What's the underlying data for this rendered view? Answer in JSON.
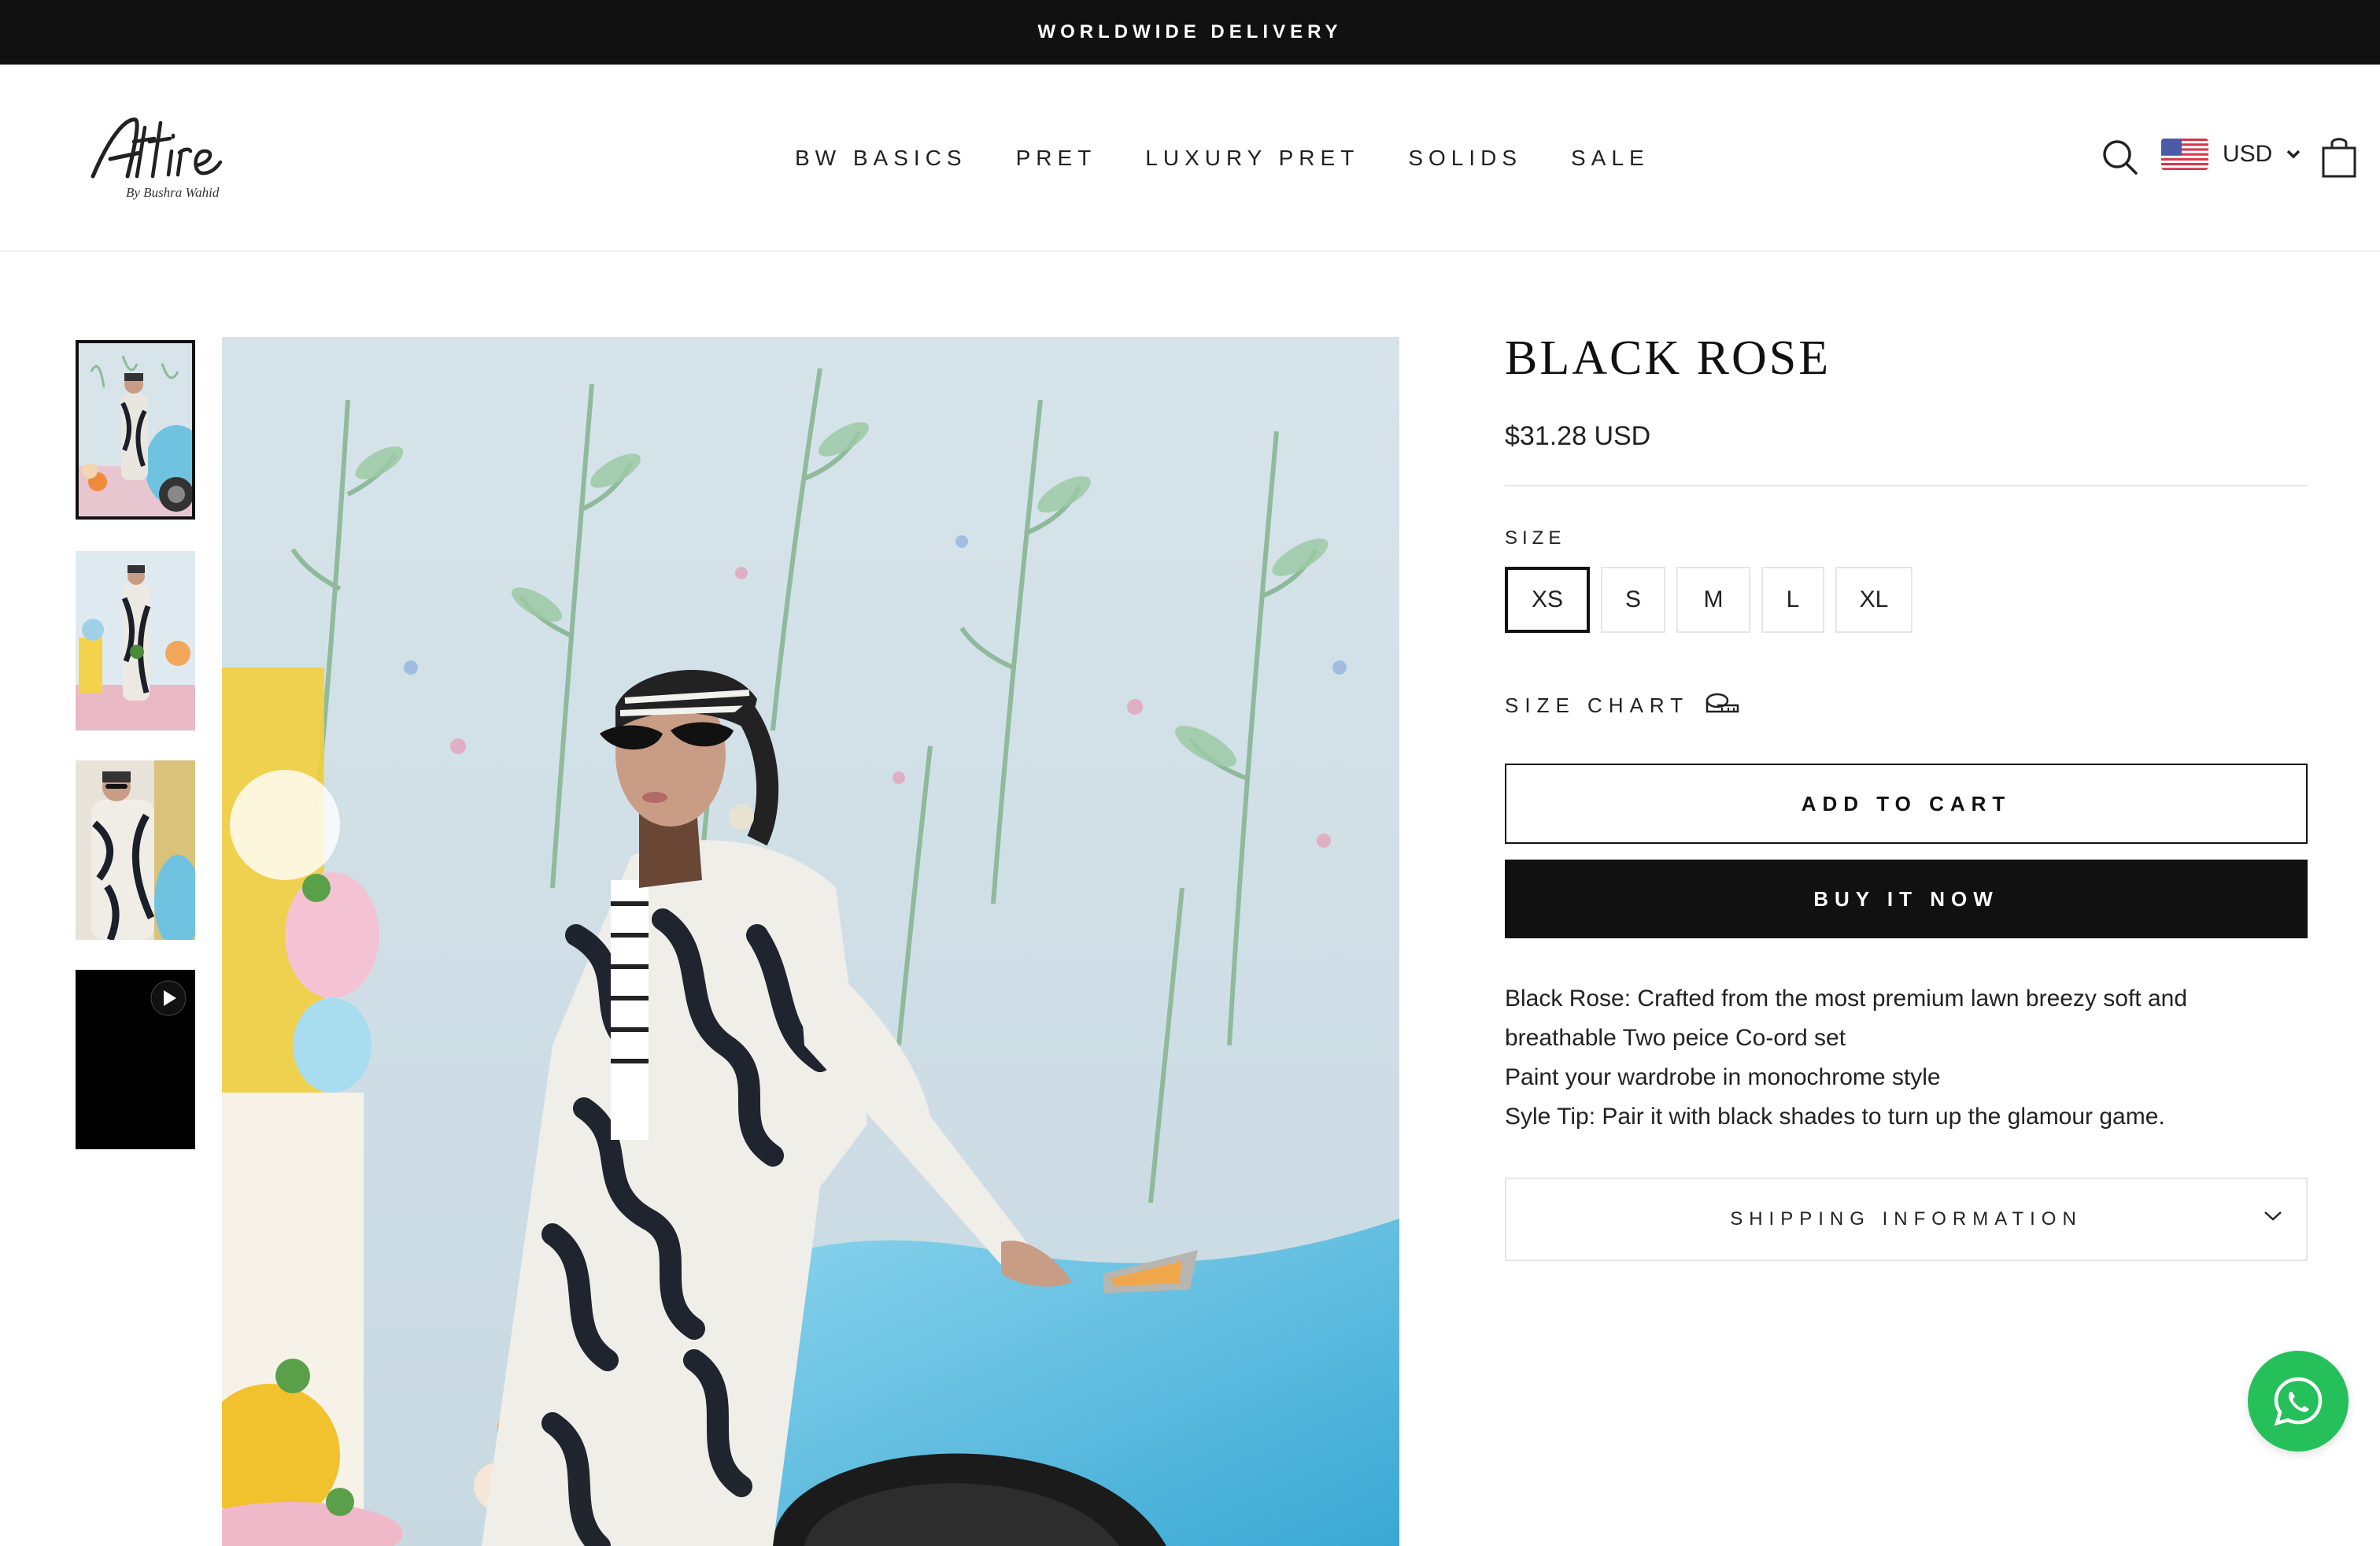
{
  "announcement": {
    "text": "WORLDWIDE DELIVERY"
  },
  "header": {
    "logo_text": "Attire",
    "logo_subtext": "By Bushra Wahid",
    "nav": [
      "BW BASICS",
      "PRET",
      "LUXURY PRET",
      "SOLIDS",
      "SALE"
    ],
    "currency": "USD",
    "icons": [
      "search-icon",
      "us-flag-icon",
      "chevron-down-icon",
      "shopping-bag-icon"
    ]
  },
  "gallery": {
    "thumbnails": [
      "product-photo-1",
      "product-photo-2",
      "product-photo-3",
      "product-video"
    ],
    "active_index": 0
  },
  "product": {
    "title": "BLACK ROSE",
    "price": "$31.28 USD",
    "size_label": "SIZE",
    "sizes": [
      "XS",
      "S",
      "M",
      "L",
      "XL"
    ],
    "selected_size": "XS",
    "size_chart_label": "SIZE CHART",
    "add_to_cart": "ADD TO CART",
    "buy_now": "BUY IT NOW",
    "description": [
      "Black Rose: Crafted from the most premium lawn breezy soft and",
      "breathable Two peice Co-ord set",
      "Paint your wardrobe in monochrome style",
      "Syle Tip: Pair it with black shades to turn up the glamour game."
    ],
    "shipping_label": "SHIPPING INFORMATION"
  },
  "colors": {
    "dark": "#111111",
    "whatsapp": "#25c05a",
    "border": "#e6e6e6"
  }
}
